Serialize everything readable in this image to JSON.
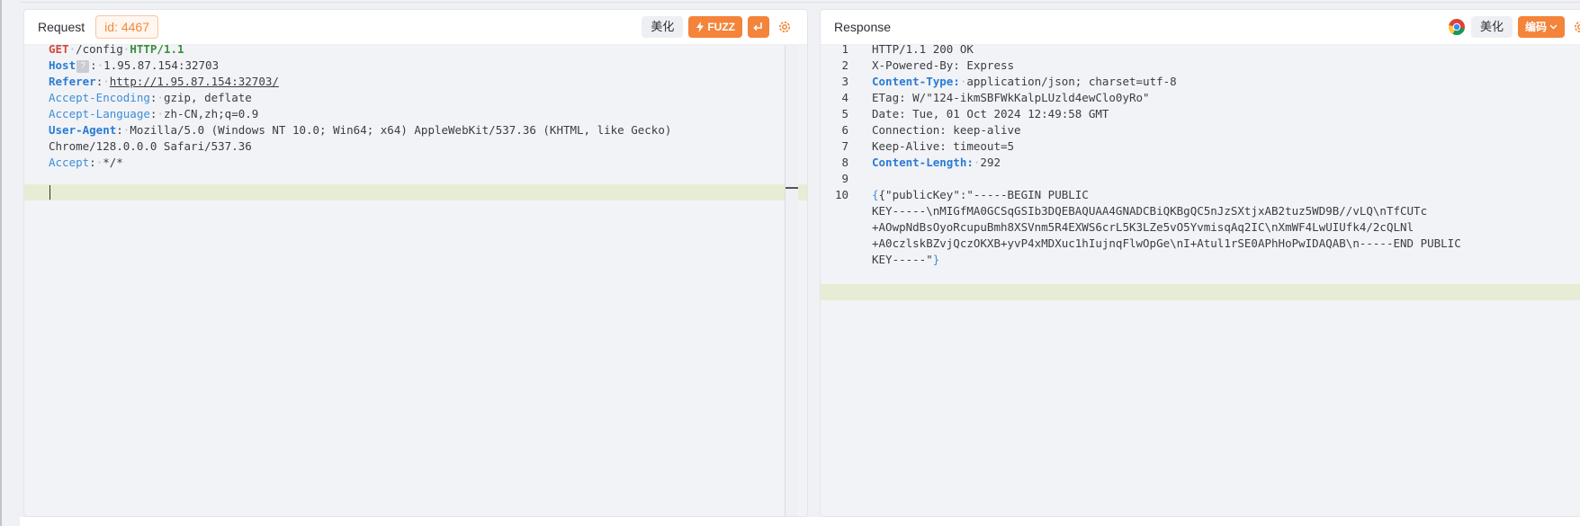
{
  "request": {
    "title": "Request",
    "id_badge": "id: 4467",
    "beautify_label": "美化",
    "fuzz_label": "FUZZ",
    "host_hint": "?",
    "lines": {
      "l1_method": "GET",
      "l1_path": "/config",
      "l1_proto": "HTTP/1.1",
      "l2_key": "Host",
      "l2_val": "1.95.87.154:32703",
      "l3_key": "Referer",
      "l3_val": "http://1.95.87.154:32703/",
      "l4_key": "Accept-Encoding",
      "l4_val": "gzip, deflate",
      "l5_key": "Accept-Language",
      "l5_val": "zh-CN,zh;q=0.9",
      "l6_key": "User-Agent",
      "l6_val": "Mozilla/5.0 (Windows NT 10.0; Win64; x64) AppleWebKit/537.36 (KHTML, like Gecko)",
      "l7_val": "Chrome/128.0.0.0 Safari/537.36",
      "l8_key": "Accept",
      "l8_val": "*/*"
    }
  },
  "response": {
    "title": "Response",
    "beautify_label": "美化",
    "encoding_label": "编码",
    "line_numbers": [
      "1",
      "2",
      "3",
      "4",
      "5",
      "6",
      "7",
      "8",
      "9",
      "10"
    ],
    "lines": {
      "l1": "HTTP/1.1 200 OK",
      "l2": "X-Powered-By: Express",
      "l3_key": "Content-Type:",
      "l3_val": "application/json; charset=utf-8",
      "l4": "ETag: W/\"124-ikmSBFWkKalpLUzld4ewClo0yRo\"",
      "l5": "Date: Tue, 01 Oct 2024 12:49:58 GMT",
      "l6": "Connection: keep-alive",
      "l7": "Keep-Alive: timeout=5",
      "l8_key": "Content-Length:",
      "l8_val": "292",
      "l10_a": "{\"publicKey\":\"-----BEGIN PUBLIC",
      "l10_b": "KEY-----\\nMIGfMA0GCSqGSIb3DQEBAQUAA4GNADCBiQKBgQC5nJzSXtjxAB2tuz5WD9B//vLQ\\nTfCUTc",
      "l10_c": "+AOwpNdBsOyoRcupuBmh8XSVnm5R4EXWS6crL5K3LZe5vO5YvmisqAq2IC\\nXmWF4LwUIUfk4/2cQLNl",
      "l10_d": "+A0czlskBZvjQczOKXB+yvP4xMDXuc1hIujnqFlwOpGe\\nI+Atul1rSE0APhHoPwIDAQAB\\n-----END PUBLIC",
      "l10_e": "KEY-----\"",
      "l10_close": "}"
    }
  },
  "colors": {
    "accent": "#f3843a",
    "header_key": "#2a7cd3",
    "method": "#d1493f",
    "protocol": "#3a8f3c",
    "current_line": "#e6edd4"
  }
}
